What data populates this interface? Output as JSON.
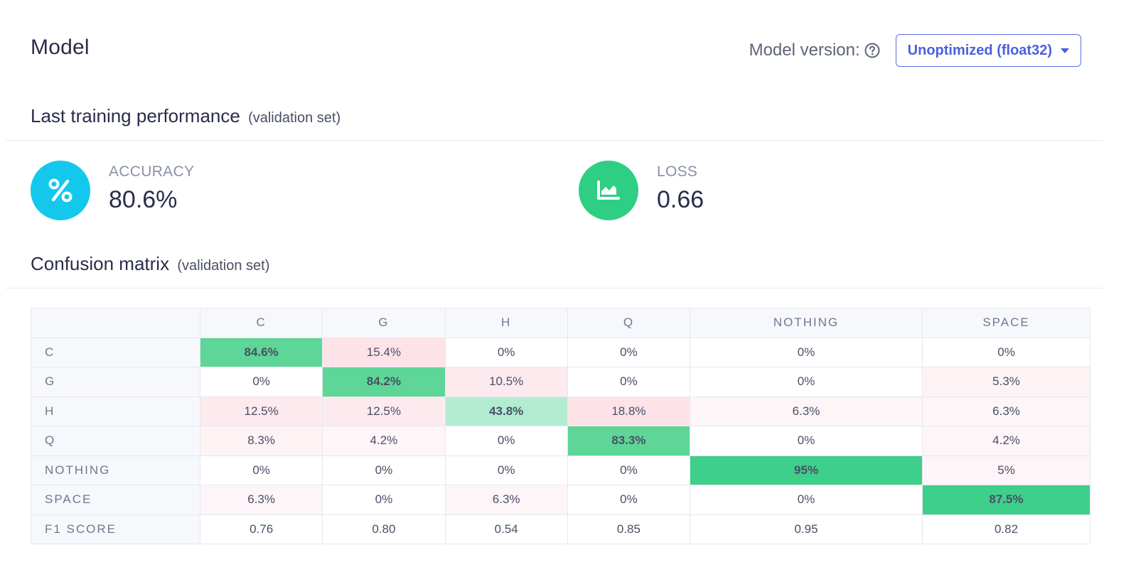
{
  "header": {
    "title": "Model",
    "version_label": "Model version:",
    "version_selected": "Unoptimized (float32)"
  },
  "performance": {
    "title": "Last training performance",
    "subtitle": "(validation set)",
    "accuracy": {
      "label": "ACCURACY",
      "value": "80.6%",
      "color": "#13c8ec"
    },
    "loss": {
      "label": "LOSS",
      "value": "0.66",
      "color": "#2ecf85"
    }
  },
  "confusion": {
    "title": "Confusion matrix",
    "subtitle": "(validation set)",
    "columns": [
      "C",
      "G",
      "H",
      "Q",
      "NOTHING",
      "SPACE"
    ],
    "rows": [
      {
        "label": "C",
        "cells": [
          "84.6%",
          "15.4%",
          "0%",
          "0%",
          "0%",
          "0%"
        ]
      },
      {
        "label": "G",
        "cells": [
          "0%",
          "84.2%",
          "10.5%",
          "0%",
          "0%",
          "5.3%"
        ]
      },
      {
        "label": "H",
        "cells": [
          "12.5%",
          "12.5%",
          "43.8%",
          "18.8%",
          "6.3%",
          "6.3%"
        ]
      },
      {
        "label": "Q",
        "cells": [
          "8.3%",
          "4.2%",
          "0%",
          "83.3%",
          "0%",
          "4.2%"
        ]
      },
      {
        "label": "NOTHING",
        "cells": [
          "0%",
          "0%",
          "0%",
          "0%",
          "95%",
          "5%"
        ]
      },
      {
        "label": "SPACE",
        "cells": [
          "6.3%",
          "0%",
          "6.3%",
          "0%",
          "0%",
          "87.5%"
        ]
      }
    ],
    "f1": {
      "label": "F1 SCORE",
      "cells": [
        "0.76",
        "0.80",
        "0.54",
        "0.85",
        "0.95",
        "0.82"
      ]
    }
  }
}
